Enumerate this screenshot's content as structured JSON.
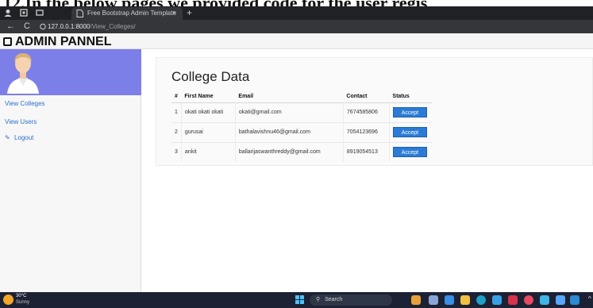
{
  "document": {
    "caption_fragment": "12.In the below pages we provided code for the user regis"
  },
  "browser": {
    "tab_title": "Free Bootstrap Admin Template",
    "tab_close": "×",
    "new_tab": "+",
    "back": "←",
    "reload": "C",
    "url_host": "127.0.0.1:8000",
    "url_path": "/View_Colleges/"
  },
  "header": {
    "brand": "ADMIN PANNEL"
  },
  "sidebar": {
    "items": [
      {
        "label": "View Colleges"
      },
      {
        "label": "View Users"
      },
      {
        "label": "Logout",
        "icon": "✎"
      }
    ]
  },
  "main": {
    "title": "College Data",
    "table": {
      "columns": [
        "#",
        "First Name",
        "Email",
        "Contact",
        "Status"
      ],
      "rows": [
        {
          "num": "1",
          "name": "okati okati okati",
          "email": "okati@gmail.com",
          "contact": "7674585806",
          "status": "Accept"
        },
        {
          "num": "2",
          "name": "gurusai",
          "email": "bathalavishnu46@gmail.com",
          "contact": "7054123696",
          "status": "Accept"
        },
        {
          "num": "3",
          "name": "ankit",
          "email": "ballarijaswanthreddy@gmail.com",
          "contact": "8919054513",
          "status": "Accept"
        }
      ]
    }
  },
  "taskbar": {
    "weather_temp": "30°C",
    "weather_desc": "Sunny",
    "search_label": "Search",
    "chevron": "^",
    "accent": "#4cc2ff"
  }
}
